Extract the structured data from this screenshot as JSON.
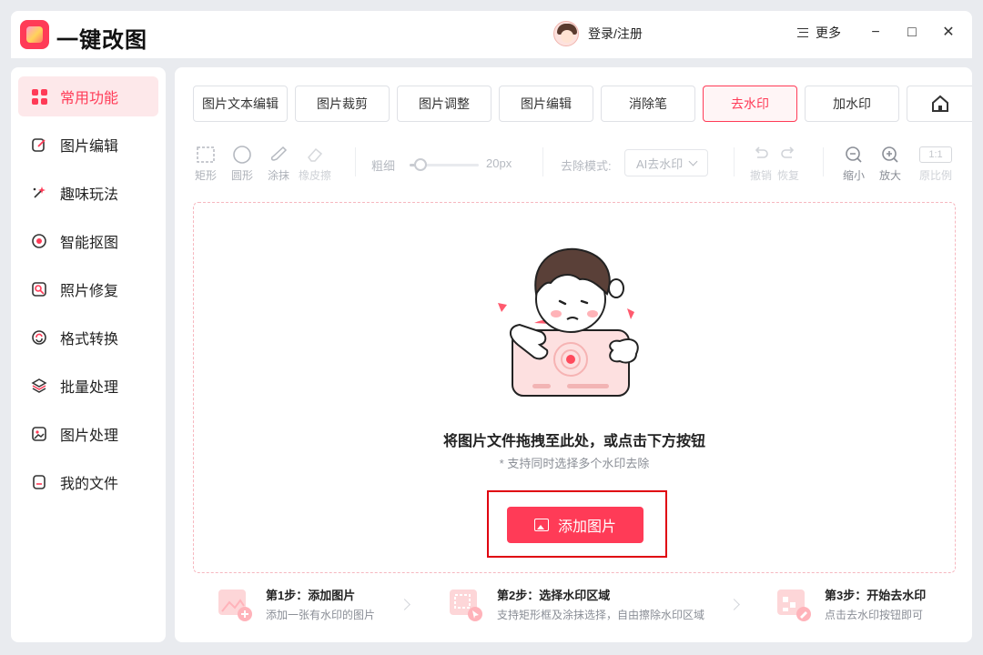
{
  "app": {
    "title": "一键改图"
  },
  "header": {
    "login_label": "登录/注册",
    "more_label": "更多",
    "minimize": "−",
    "maximize": "□",
    "close": "✕"
  },
  "sidebar": {
    "items": [
      {
        "label": "常用功能",
        "icon": "grid-icon",
        "active": true
      },
      {
        "label": "图片编辑",
        "icon": "edit-icon"
      },
      {
        "label": "趣味玩法",
        "icon": "sparkle-icon"
      },
      {
        "label": "智能抠图",
        "icon": "cutout-icon"
      },
      {
        "label": "照片修复",
        "icon": "repair-icon"
      },
      {
        "label": "格式转换",
        "icon": "convert-icon"
      },
      {
        "label": "批量处理",
        "icon": "layers-icon"
      },
      {
        "label": "图片处理",
        "icon": "image-icon"
      },
      {
        "label": "我的文件",
        "icon": "file-icon"
      }
    ]
  },
  "tabs": [
    {
      "label": "图片文本编辑"
    },
    {
      "label": "图片裁剪"
    },
    {
      "label": "图片调整"
    },
    {
      "label": "图片编辑"
    },
    {
      "label": "消除笔"
    },
    {
      "label": "去水印",
      "active": true
    },
    {
      "label": "加水印"
    }
  ],
  "toolbar": {
    "rect": "矩形",
    "circle": "圆形",
    "brush": "涂抹",
    "eraser": "橡皮擦",
    "thickness_label": "粗细",
    "thickness_value": "20px",
    "mode_label": "去除模式:",
    "mode_value": "AI去水印",
    "undo": "撤销",
    "redo": "恢复",
    "zoom_out": "缩小",
    "zoom_in": "放大",
    "ratio_badge": "1:1",
    "ratio_label": "原比例"
  },
  "dropzone": {
    "title": "将图片文件拖拽至此处，或点击下方按钮",
    "subtitle": "* 支持同时选择多个水印去除",
    "button_label": "添加图片"
  },
  "steps": [
    {
      "title": "第1步：添加图片",
      "desc": "添加一张有水印的图片"
    },
    {
      "title": "第2步：选择水印区域",
      "desc": "支持矩形框及涂抹选择，自由擦除水印区域"
    },
    {
      "title": "第3步：开始去水印",
      "desc": "点击去水印按钮即可"
    }
  ],
  "colors": {
    "accent": "#ff3b57",
    "highlight": "#e0000f"
  }
}
